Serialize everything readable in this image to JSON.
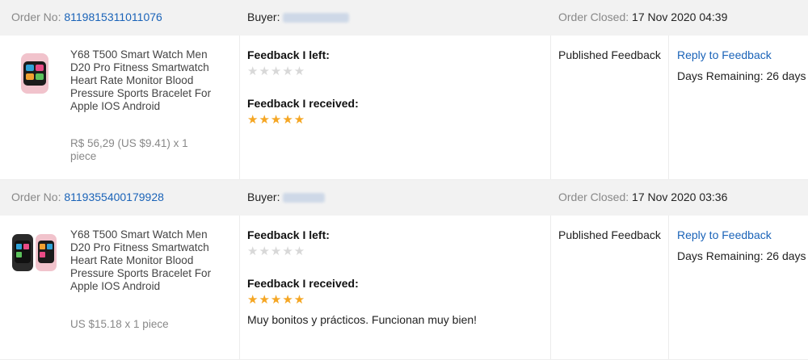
{
  "orders": [
    {
      "order_label": "Order No:",
      "order_no": "8119815311011076",
      "buyer_label": "Buyer:",
      "closed_label": "Order Closed:",
      "closed_date": "17 Nov 2020 04:39",
      "product_title": "Y68 T500 Smart Watch Men D20 Pro Fitness Smartwatch Heart Rate Monitor Blood Pressure Sports Bracelet For Apple IOS Android",
      "price": "R$ 56,29 (US $9.41) x 1 piece",
      "feedback_left_label": "Feedback I left:",
      "feedback_left_stars": 0,
      "feedback_received_label": "Feedback I received:",
      "feedback_received_stars": 5,
      "comment": "",
      "status": "Published Feedback",
      "reply_link": "Reply to Feedback",
      "days_remaining": "Days Remaining: 26 days",
      "thumb_color": "#f1c3cc"
    },
    {
      "order_label": "Order No:",
      "order_no": "8119355400179928",
      "buyer_label": "Buyer:",
      "closed_label": "Order Closed:",
      "closed_date": "17 Nov 2020 03:36",
      "product_title": "Y68 T500 Smart Watch Men D20 Pro Fitness Smartwatch Heart Rate Monitor Blood Pressure Sports Bracelet For Apple IOS Android",
      "price": "US $15.18 x 1 piece",
      "feedback_left_label": "Feedback I left:",
      "feedback_left_stars": 0,
      "feedback_received_label": "Feedback I received:",
      "feedback_received_stars": 5,
      "comment": "Muy bonitos y prácticos. Funcionan muy bien!",
      "status": "Published Feedback",
      "reply_link": "Reply to Feedback",
      "days_remaining": "Days Remaining: 26 days",
      "thumb_color": "#333333"
    }
  ]
}
